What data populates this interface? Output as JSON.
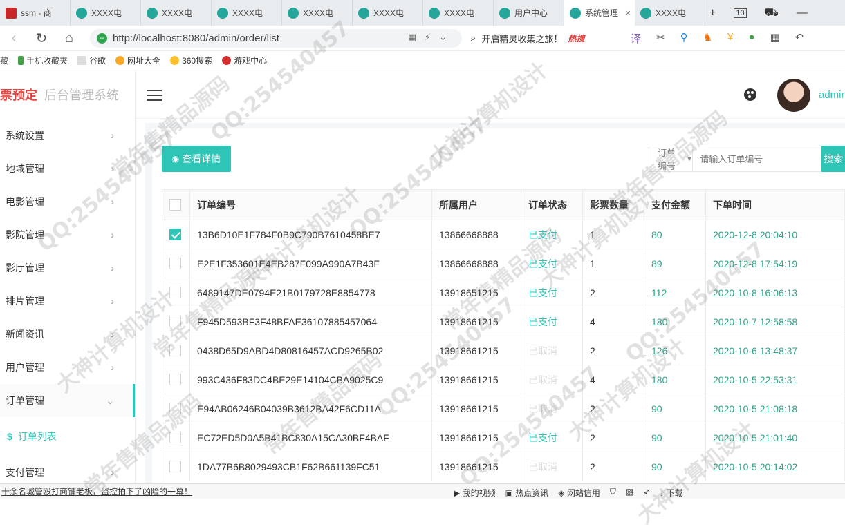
{
  "browser": {
    "tabs": [
      {
        "label": "ssm - 商",
        "fav_color": "#c62828"
      },
      {
        "label": "XXXX电",
        "fav_color": "#26a69a"
      },
      {
        "label": "XXXX电",
        "fav_color": "#26a69a"
      },
      {
        "label": "XXXX电",
        "fav_color": "#26a69a"
      },
      {
        "label": "XXXX电",
        "fav_color": "#26a69a"
      },
      {
        "label": "XXXX电",
        "fav_color": "#26a69a"
      },
      {
        "label": "XXXX电",
        "fav_color": "#26a69a"
      },
      {
        "label": "用户中心",
        "fav_color": "#26a69a"
      },
      {
        "label": "系统管理",
        "fav_color": "#26a69a"
      },
      {
        "label": "XXXX电",
        "fav_color": "#26a69a"
      }
    ],
    "tab_count": "10",
    "url": "http://localhost:8080/admin/order/list",
    "search_text": "开启精灵收集之旅！",
    "hot_label": "热搜",
    "bookmarks": [
      "手机收藏夹",
      "谷歌",
      "网址大全",
      "360搜索",
      "游戏中心"
    ],
    "bookmarks_prefix": "藏"
  },
  "app": {
    "brand_title": "票预定",
    "brand_subtitle": "后台管理系统",
    "user": "admin",
    "menu": [
      {
        "label": "系统设置",
        "arrow": "›"
      },
      {
        "label": "地域管理",
        "arrow": "›"
      },
      {
        "label": "电影管理",
        "arrow": "›"
      },
      {
        "label": "影院管理",
        "arrow": "›"
      },
      {
        "label": "影厅管理",
        "arrow": "›"
      },
      {
        "label": "排片管理",
        "arrow": "›"
      },
      {
        "label": "新闻资讯",
        "arrow": "›"
      },
      {
        "label": "用户管理",
        "arrow": "›"
      },
      {
        "label": "订单管理",
        "arrow": "⌄"
      }
    ],
    "submenu": {
      "icon": "$",
      "label": "订单列表"
    },
    "menu_after": {
      "label": "支付管理",
      "arrow": "›"
    }
  },
  "toolbar": {
    "detail_button": "查看详情",
    "filter_select": "订单编号",
    "search_placeholder": "请输入订单编号",
    "search_button": "搜索"
  },
  "table": {
    "headers": [
      "订单编号",
      "所属用户",
      "订单状态",
      "影票数量",
      "支付金额",
      "下单时间"
    ],
    "rows": [
      {
        "checked": true,
        "order_no": "13B6D10E1F784F0B9C790B7610458BE7",
        "user": "13866668888",
        "status": "已支付",
        "qty": "1",
        "amount": "80",
        "time": "2020-12-8 20:04:10"
      },
      {
        "checked": false,
        "order_no": "E2E1F353601E4EB287F099A990A7B43F",
        "user": "13866668888",
        "status": "已支付",
        "qty": "1",
        "amount": "89",
        "time": "2020-12-8 17:54:19"
      },
      {
        "checked": false,
        "order_no": "6489147DE0794E21B0179728E8854778",
        "user": "13918651215",
        "status": "已支付",
        "qty": "2",
        "amount": "112",
        "time": "2020-10-8 16:06:13"
      },
      {
        "checked": false,
        "order_no": "F945D593BF3F48BFAE36107885457064",
        "user": "13918661215",
        "status": "已支付",
        "qty": "4",
        "amount": "180",
        "time": "2020-10-7 12:58:58"
      },
      {
        "checked": false,
        "order_no": "0438D65D9ABD4D80816457ACD9265B02",
        "user": "13918661215",
        "status": "已取消",
        "qty": "2",
        "amount": "126",
        "time": "2020-10-6 13:48:37"
      },
      {
        "checked": false,
        "order_no": "993C436F83DC4BE29E14104CBA9025C9",
        "user": "13918661215",
        "status": "已取消",
        "qty": "4",
        "amount": "180",
        "time": "2020-10-5 22:53:31"
      },
      {
        "checked": false,
        "order_no": "E94AB06246B04039B3612BA42F6CD11A",
        "user": "13918661215",
        "status": "已取消",
        "qty": "2",
        "amount": "90",
        "time": "2020-10-5 21:08:18"
      },
      {
        "checked": false,
        "order_no": "EC72ED5D0A5B41BC830A15CA30BF4BAF",
        "user": "13918661215",
        "status": "已支付",
        "qty": "2",
        "amount": "90",
        "time": "2020-10-5 21:01:40"
      },
      {
        "checked": false,
        "order_no": "1DA77B6B8029493CB1F62B661139FC51",
        "user": "13918661215",
        "status": "已取消",
        "qty": "2",
        "amount": "90",
        "time": "2020-10-5 20:14:02"
      }
    ]
  },
  "statusbar": {
    "news": "十余名城管殴打商铺老板，监控拍下了凶险的一幕！",
    "items": [
      "我的视频",
      "热点资讯",
      "网站信用",
      "下载"
    ]
  },
  "watermarks": [
    "QQ:254540457",
    "大神计算机设计",
    "常年售精品源码"
  ],
  "colors": {
    "accent": "#2ec4b6",
    "brand": "#e04848",
    "paid": "#2ec4b6",
    "cancelled": "#dddddd"
  }
}
